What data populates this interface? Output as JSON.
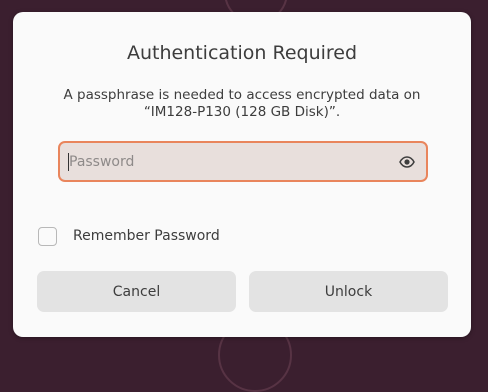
{
  "dialog": {
    "title": "Authentication Required",
    "message": "A passphrase is needed to access encrypted data on “IM128-P130 (128 GB Disk)”.",
    "password": {
      "placeholder": "Password",
      "value": ""
    },
    "remember": {
      "label": "Remember Password",
      "checked": false
    },
    "buttons": {
      "cancel": "Cancel",
      "unlock": "Unlock"
    }
  },
  "icons": {
    "reveal": "eye-icon"
  },
  "colors": {
    "focus_border": "#e9855c",
    "input_bg": "#e8dfdc",
    "dialog_bg": "#fafafa",
    "button_bg": "#e3e3e3",
    "background": "#3b1f2f"
  }
}
